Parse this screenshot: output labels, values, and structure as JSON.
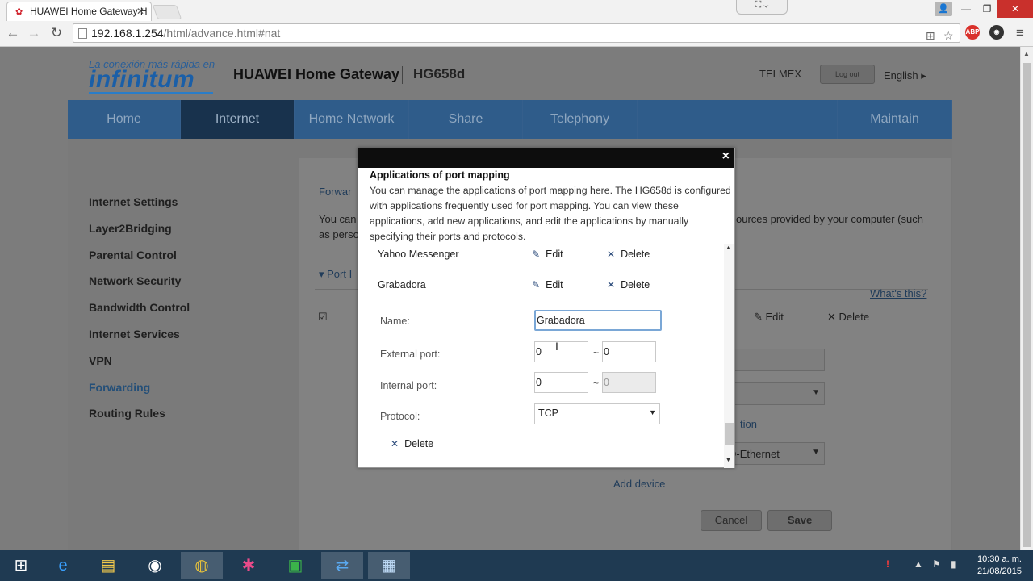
{
  "browser": {
    "tab_title": "HUAWEI Home Gateway H",
    "url_host": "192.168.1.254",
    "url_path": "/html/advance.html#nat",
    "win_min": "—",
    "win_restore": "❐",
    "win_close": "✕"
  },
  "header": {
    "logo_tagline": "La conexión más rápida en",
    "logo_brand": "infinitum",
    "product": "HUAWEI Home Gateway",
    "model": "HG658d",
    "isp": "TELMEX",
    "logout": "Log out",
    "language": "English ▸"
  },
  "nav": [
    "Home",
    "Internet",
    "Home Network",
    "Share",
    "Telephony",
    "Maintain"
  ],
  "nav_active": "Internet",
  "sidebar": [
    "Internet Settings",
    "Layer2Bridging",
    "Parental Control",
    "Network Security",
    "Bandwidth Control",
    "Internet Services",
    "VPN",
    "Forwarding",
    "Routing Rules"
  ],
  "sidebar_active": "Forwarding",
  "background": {
    "section": "Forwar",
    "desc1": "You can",
    "desc1b": "ources provided by your computer (such",
    "desc2": "as perso",
    "port_heading": "Port I",
    "whats_this": "What's this?",
    "edit": "Edit",
    "delete": "Delete",
    "tion": "tion",
    "ethernet": "D-Ethernet",
    "add_device": "Add device",
    "cancel": "Cancel",
    "save": "Save"
  },
  "modal": {
    "close": "×",
    "title": "Applications of port mapping",
    "description": "You can manage the applications of port mapping here. The HG658d is configured with applications frequently used for port mapping. You can view these applications, add new applications, and edit the applications by manually specifying their ports and protocols.",
    "apps": [
      {
        "name": "Yahoo Messenger",
        "edit": "Edit",
        "delete": "Delete"
      },
      {
        "name": "Grabadora",
        "edit": "Edit",
        "delete": "Delete"
      }
    ],
    "form": {
      "name_label": "Name:",
      "name_value": "Grabadora",
      "external_label": "External port:",
      "external_start": "0",
      "external_end": "0",
      "internal_label": "Internal port:",
      "internal_start": "0",
      "internal_end": "0",
      "protocol_label": "Protocol:",
      "protocol_value": "TCP",
      "delete": "Delete"
    }
  },
  "taskbar": {
    "time": "10:30 a. m.",
    "date": "21/08/2015"
  }
}
